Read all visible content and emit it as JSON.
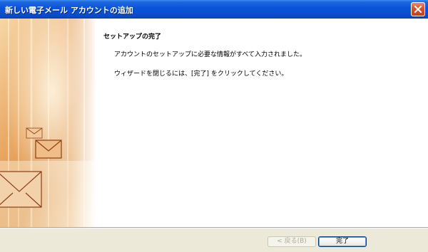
{
  "window": {
    "title": "新しい電子メール アカウントの追加"
  },
  "main": {
    "heading": "セットアップの完了",
    "message1": "アカウントのセットアップに必要な情報がすべて入力されました。",
    "message2": "ウィザードを閉じるには、[完了] をクリックしてください。"
  },
  "footer": {
    "back_label": "< 戻る(B)",
    "finish_label": "完了"
  },
  "colors": {
    "titlebar": "#0a53d9",
    "art_orange": "#d77a2c",
    "art_light": "#f7e2b8",
    "close_button": "#d8552f"
  },
  "icons": {
    "close": "close-icon",
    "envelopes": "envelope-icon"
  }
}
